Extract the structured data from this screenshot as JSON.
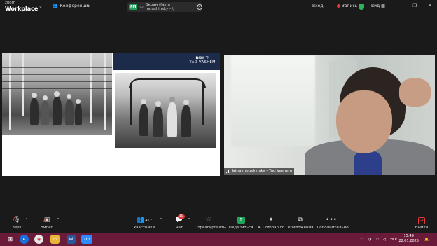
{
  "app": {
    "brand_top": "zoom",
    "brand_name": "Workplace"
  },
  "topbar": {
    "conferences_label": "Конференции",
    "share_badge": "FM",
    "share_label": "Экран (faina moushinsky - \\",
    "enter_label": "Вход",
    "record_label": "Запись",
    "view_label": "Вид"
  },
  "shared_screen": {
    "logo_hebrew": "יד ושם",
    "logo_latin": "YAD VASHEM"
  },
  "participant": {
    "name": "faina moushinsky - Yad Vashem"
  },
  "toolbar": {
    "audio_label": "Звук",
    "video_label": "Видео",
    "participants_label": "Участники",
    "participants_count": "412",
    "chat_label": "Чат",
    "chat_badge": "10",
    "react_label": "Отреагировать",
    "share_label": "Поделиться",
    "ai_label": "AI Companion",
    "apps_label": "Приложения",
    "more_label": "Дополнительно",
    "leave_label": "Выйти"
  },
  "taskbar": {
    "lang": "УКР",
    "time": "15:49",
    "date": "22.01.2025"
  },
  "colors": {
    "accent_green": "#20a45c",
    "record_red": "#e23b3b",
    "taskbar": "#6a1b3a"
  }
}
